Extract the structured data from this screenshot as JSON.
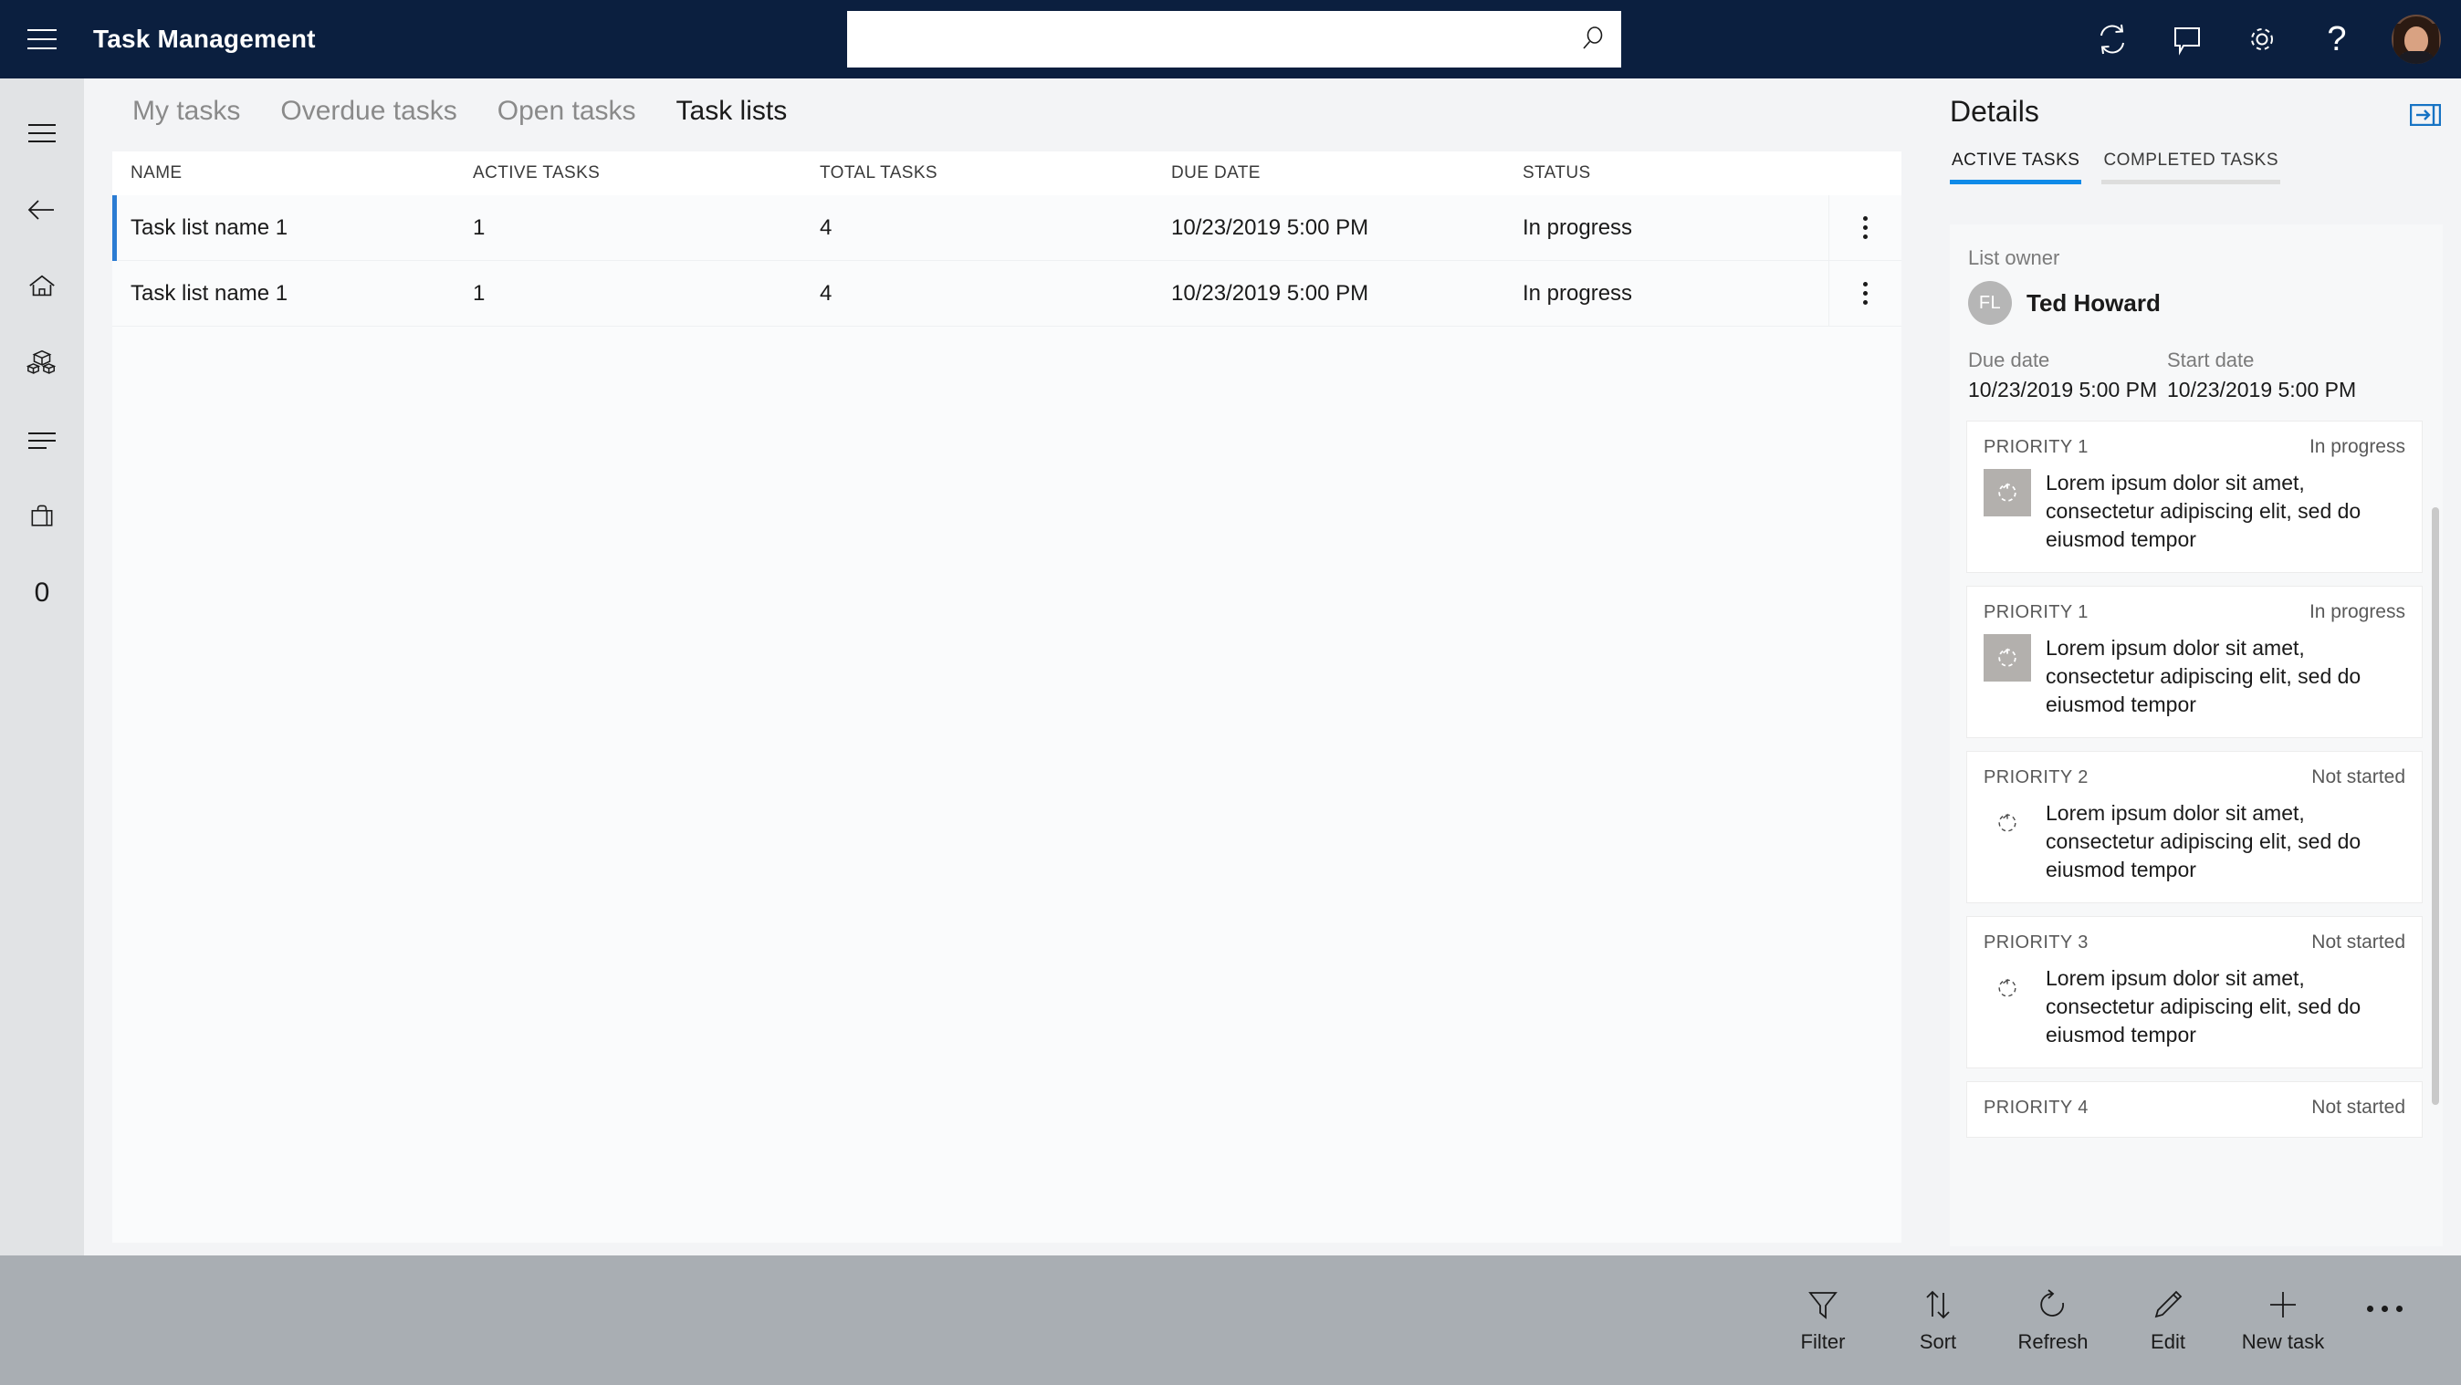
{
  "topbar": {
    "title": "Task Management",
    "menu_icon": "hamburger-icon",
    "search": {
      "value": "",
      "placeholder": ""
    },
    "icons": [
      "sync-icon",
      "chat-bubble-icon",
      "gear-icon",
      "help-icon"
    ],
    "help_glyph": "?"
  },
  "rail": {
    "items": [
      {
        "name": "hamburger",
        "label": ""
      },
      {
        "name": "back-arrow",
        "label": ""
      },
      {
        "name": "home",
        "label": ""
      },
      {
        "name": "products",
        "label": ""
      },
      {
        "name": "list",
        "label": ""
      },
      {
        "name": "briefcase",
        "label": ""
      },
      {
        "name": "zero",
        "label": "0"
      }
    ]
  },
  "tabs": [
    {
      "label": "My tasks",
      "active": false
    },
    {
      "label": "Overdue tasks",
      "active": false
    },
    {
      "label": "Open tasks",
      "active": false
    },
    {
      "label": "Task lists",
      "active": true
    }
  ],
  "table": {
    "columns": [
      "NAME",
      "ACTIVE TASKS",
      "TOTAL TASKS",
      "DUE DATE",
      "STATUS"
    ],
    "rows": [
      {
        "name": "Task list name 1",
        "active_tasks": "1",
        "total_tasks": "4",
        "due_date": "10/23/2019 5:00 PM",
        "status": "In progress",
        "selected": true
      },
      {
        "name": "Task list name 1",
        "active_tasks": "1",
        "total_tasks": "4",
        "due_date": "10/23/2019 5:00 PM",
        "status": "In progress",
        "selected": false
      }
    ]
  },
  "details": {
    "title": "Details",
    "collapse_icon": "collapse-panel-icon",
    "tabs": [
      {
        "label": "ACTIVE TASKS",
        "active": true
      },
      {
        "label": "COMPLETED TASKS",
        "active": false
      }
    ],
    "owner_label": "List owner",
    "owner_initials": "FL",
    "owner_name": "Ted Howard",
    "due_date_label": "Due date",
    "due_date_value": "10/23/2019 5:00 PM",
    "start_date_label": "Start date",
    "start_date_value": "10/23/2019 5:00 PM",
    "cards": [
      {
        "priority": "PRIORITY 1",
        "status": "In progress",
        "text": "Lorem ipsum dolor sit amet, consectetur adipiscing elit, sed do eiusmod tempor",
        "icon": "in-progress-icon",
        "filled": true
      },
      {
        "priority": "PRIORITY 1",
        "status": "In progress",
        "text": "Lorem ipsum dolor sit amet, consectetur adipiscing elit, sed do eiusmod tempor",
        "icon": "in-progress-icon",
        "filled": true
      },
      {
        "priority": "PRIORITY 2",
        "status": "Not started",
        "text": "Lorem ipsum dolor sit amet, consectetur adipiscing elit, sed do eiusmod tempor",
        "icon": "not-started-icon",
        "filled": false
      },
      {
        "priority": "PRIORITY 3",
        "status": "Not started",
        "text": "Lorem ipsum dolor sit amet, consectetur adipiscing elit, sed do eiusmod tempor",
        "icon": "not-started-icon",
        "filled": false
      },
      {
        "priority": "PRIORITY 4",
        "status": "Not started",
        "text": "",
        "icon": "not-started-icon",
        "filled": false
      }
    ]
  },
  "toolbar": {
    "items": [
      {
        "label": "Filter",
        "icon": "filter-icon"
      },
      {
        "label": "Sort",
        "icon": "sort-icon"
      },
      {
        "label": "Refresh",
        "icon": "refresh-icon"
      },
      {
        "label": "Edit",
        "icon": "pencil-icon"
      },
      {
        "label": "New task",
        "icon": "plus-icon"
      }
    ],
    "overflow_icon": "more-icon"
  },
  "colors": {
    "topbar_bg": "#0b1f3f",
    "rail_bg": "#e1e3e5",
    "content_bg": "#f3f4f6",
    "toolbar_bg": "#a9aeb3",
    "accent_blue": "#0f8ae8",
    "selection_blue": "#2b7cd3"
  }
}
